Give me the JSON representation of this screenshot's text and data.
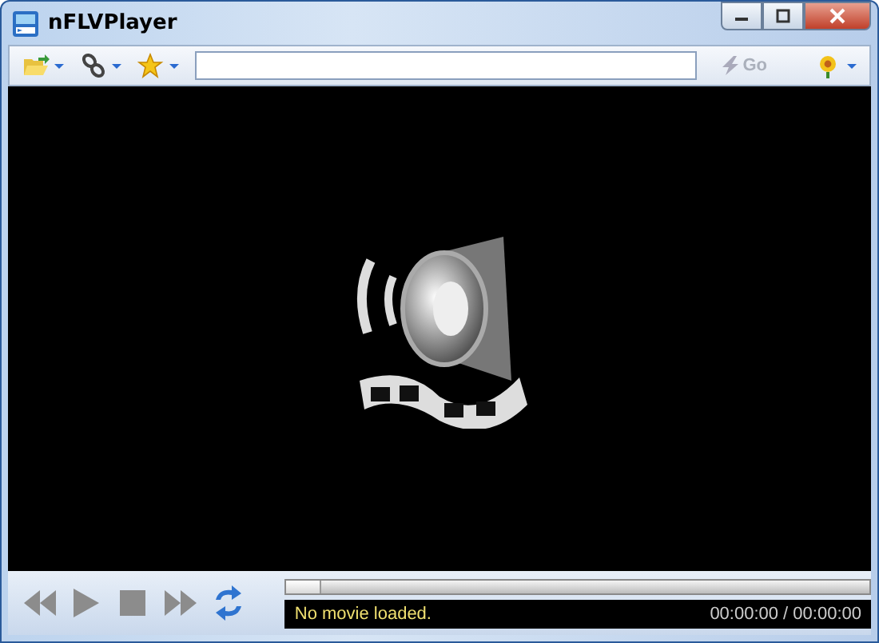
{
  "window": {
    "title": "nFLVPlayer"
  },
  "toolbar": {
    "go_button": {
      "label": "Go",
      "disabled": true
    }
  },
  "transport": [
    {
      "kind": "rewind",
      "disabled": true
    },
    {
      "kind": "play",
      "disabled": true
    },
    {
      "kind": "stop",
      "disabled": true
    },
    {
      "kind": "forward",
      "disabled": true
    },
    {
      "kind": "repeat",
      "disabled": false
    }
  ],
  "seek_bar": {
    "level": 0
  },
  "status": {
    "message": "No movie loaded.",
    "time": "00:00:00 / 00:00:00"
  }
}
